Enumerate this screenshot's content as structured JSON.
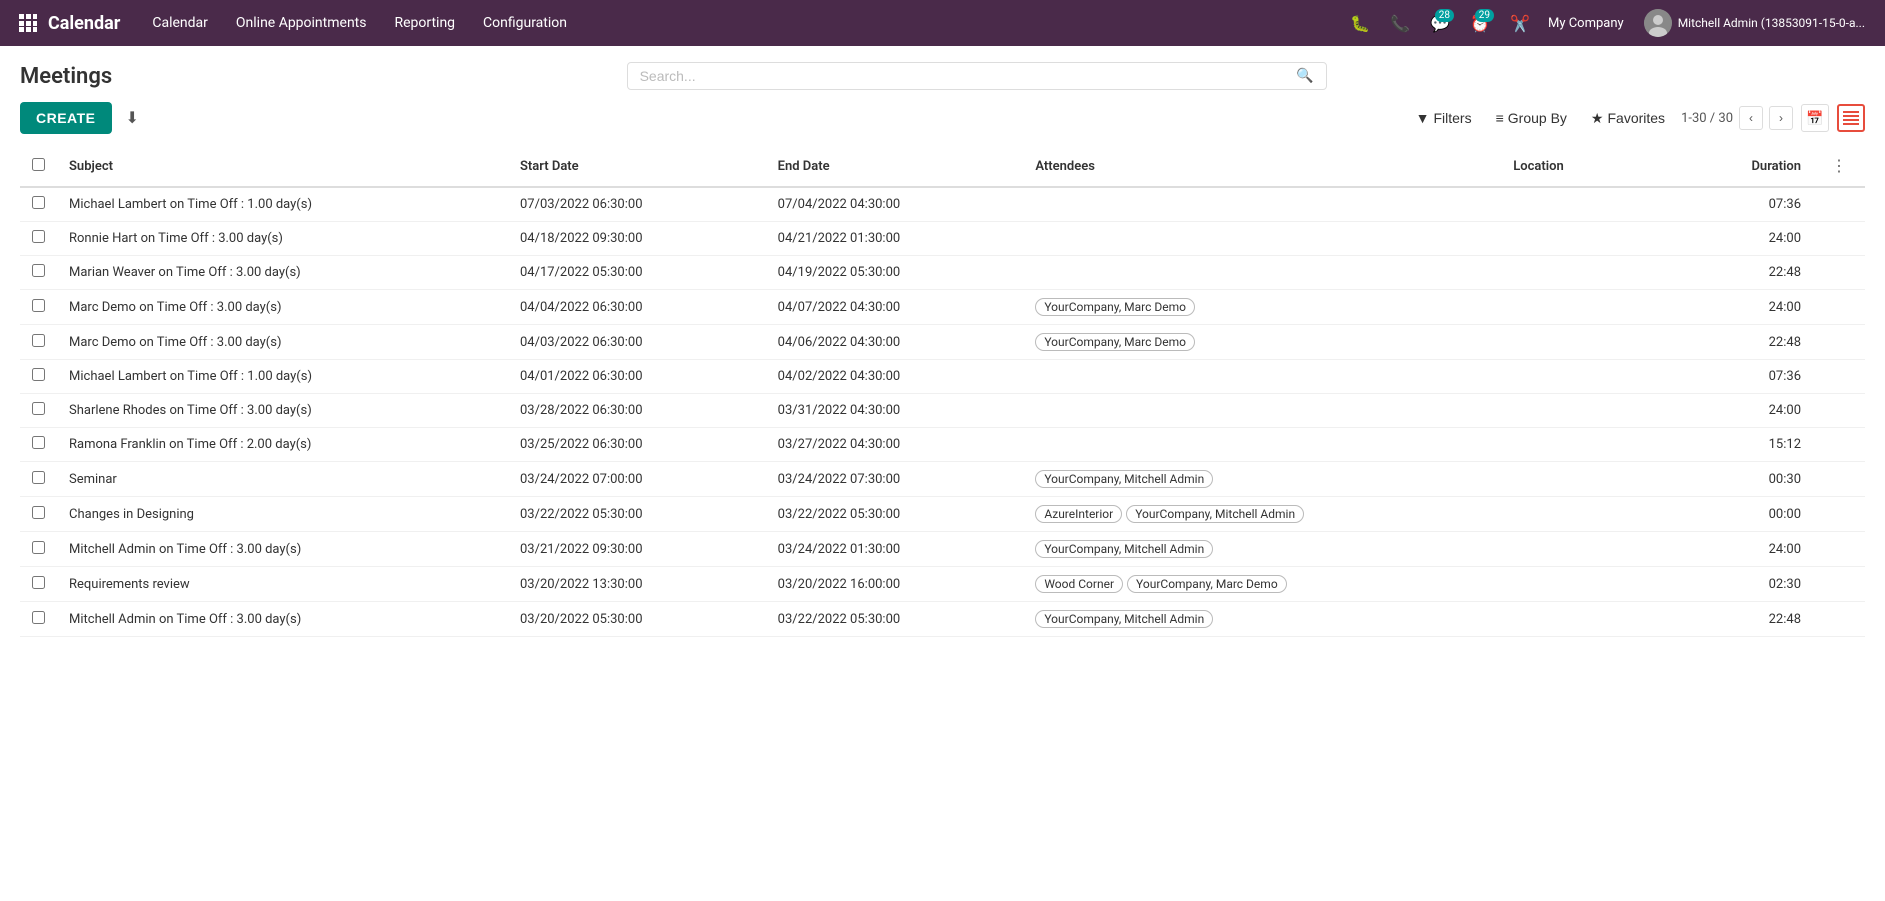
{
  "app": {
    "name": "Calendar",
    "nav_items": [
      "Calendar",
      "Online Appointments",
      "Reporting",
      "Configuration"
    ]
  },
  "topnav": {
    "company": "My Company",
    "user": "Mitchell Admin (13853091-15-0-a...",
    "badge1": "28",
    "badge2": "29"
  },
  "page": {
    "title": "Meetings",
    "create_label": "CREATE",
    "search_placeholder": "Search...",
    "filters_label": "Filters",
    "group_by_label": "Group By",
    "favorites_label": "Favorites",
    "pagination": "1-30 / 30"
  },
  "table": {
    "columns": [
      "Subject",
      "Start Date",
      "End Date",
      "Attendees",
      "Location",
      "Duration"
    ],
    "rows": [
      {
        "subject": "Michael Lambert on Time Off : 1.00 day(s)",
        "start_date": "07/03/2022 06:30:00",
        "end_date": "07/04/2022 04:30:00",
        "attendees": [],
        "location": "",
        "duration": "07:36"
      },
      {
        "subject": "Ronnie Hart on Time Off : 3.00 day(s)",
        "start_date": "04/18/2022 09:30:00",
        "end_date": "04/21/2022 01:30:00",
        "attendees": [],
        "location": "",
        "duration": "24:00"
      },
      {
        "subject": "Marian Weaver on Time Off : 3.00 day(s)",
        "start_date": "04/17/2022 05:30:00",
        "end_date": "04/19/2022 05:30:00",
        "attendees": [],
        "location": "",
        "duration": "22:48"
      },
      {
        "subject": "Marc Demo on Time Off : 3.00 day(s)",
        "start_date": "04/04/2022 06:30:00",
        "end_date": "04/07/2022 04:30:00",
        "attendees": [
          "YourCompany, Marc Demo"
        ],
        "location": "",
        "duration": "24:00"
      },
      {
        "subject": "Marc Demo on Time Off : 3.00 day(s)",
        "start_date": "04/03/2022 06:30:00",
        "end_date": "04/06/2022 04:30:00",
        "attendees": [
          "YourCompany, Marc Demo"
        ],
        "location": "",
        "duration": "22:48"
      },
      {
        "subject": "Michael Lambert on Time Off : 1.00 day(s)",
        "start_date": "04/01/2022 06:30:00",
        "end_date": "04/02/2022 04:30:00",
        "attendees": [],
        "location": "",
        "duration": "07:36"
      },
      {
        "subject": "Sharlene Rhodes on Time Off : 3.00 day(s)",
        "start_date": "03/28/2022 06:30:00",
        "end_date": "03/31/2022 04:30:00",
        "attendees": [],
        "location": "",
        "duration": "24:00"
      },
      {
        "subject": "Ramona Franklin on Time Off : 2.00 day(s)",
        "start_date": "03/25/2022 06:30:00",
        "end_date": "03/27/2022 04:30:00",
        "attendees": [],
        "location": "",
        "duration": "15:12"
      },
      {
        "subject": "Seminar",
        "start_date": "03/24/2022 07:00:00",
        "end_date": "03/24/2022 07:30:00",
        "attendees": [
          "YourCompany, Mitchell Admin"
        ],
        "location": "",
        "duration": "00:30"
      },
      {
        "subject": "Changes in Designing",
        "start_date": "03/22/2022 05:30:00",
        "end_date": "03/22/2022 05:30:00",
        "attendees": [
          "AzureInterior",
          "YourCompany, Mitchell Admin"
        ],
        "location": "",
        "duration": "00:00"
      },
      {
        "subject": "Mitchell Admin on Time Off : 3.00 day(s)",
        "start_date": "03/21/2022 09:30:00",
        "end_date": "03/24/2022 01:30:00",
        "attendees": [
          "YourCompany, Mitchell Admin"
        ],
        "location": "",
        "duration": "24:00"
      },
      {
        "subject": "Requirements review",
        "start_date": "03/20/2022 13:30:00",
        "end_date": "03/20/2022 16:00:00",
        "attendees": [
          "Wood Corner",
          "YourCompany, Marc Demo"
        ],
        "location": "",
        "duration": "02:30"
      },
      {
        "subject": "Mitchell Admin on Time Off : 3.00 day(s)",
        "start_date": "03/20/2022 05:30:00",
        "end_date": "03/22/2022 05:30:00",
        "attendees": [
          "YourCompany, Mitchell Admin"
        ],
        "location": "",
        "duration": "22:48"
      }
    ]
  }
}
